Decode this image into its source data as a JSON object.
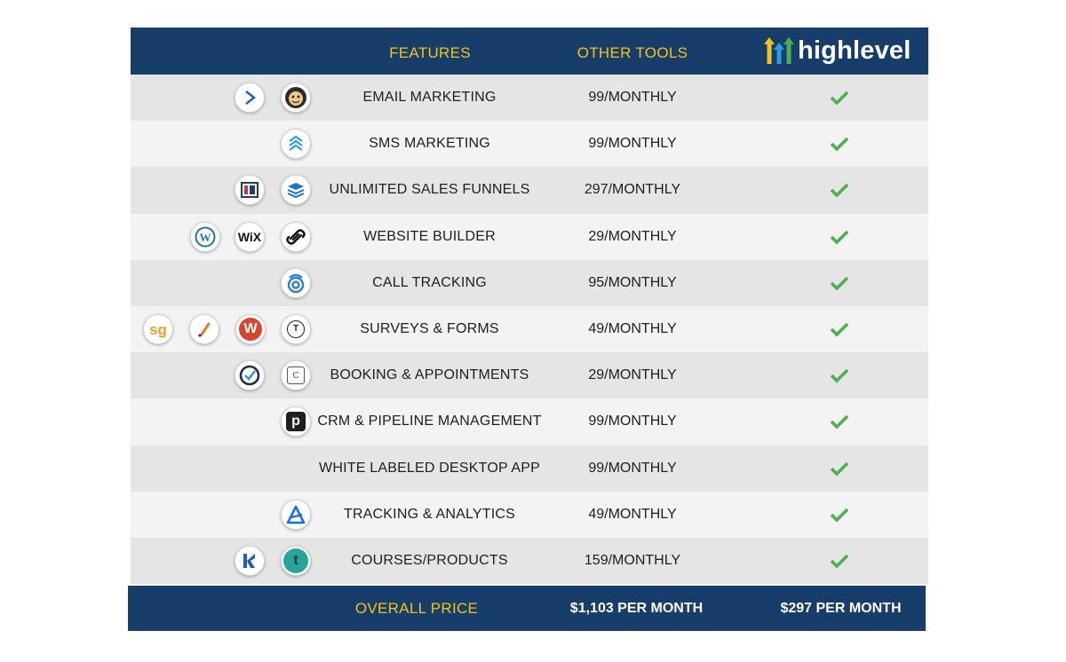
{
  "header": {
    "features_label": "FEATURES",
    "other_tools_label": "OTHER TOOLS",
    "brand_name": "highlevel"
  },
  "colors": {
    "header_bg": "#173e6b",
    "header_text": "#f5c21b",
    "check": "#4caf50",
    "row_odd": "#e5e5e5",
    "row_even": "#f3f3f3"
  },
  "rows": [
    {
      "feature": "EMAIL MARKETING",
      "price": "99/MONTHLY",
      "included": true,
      "icons": [
        "activecampaign-icon",
        "mailchimp-icon"
      ]
    },
    {
      "feature": "SMS MARKETING",
      "price": "99/MONTHLY",
      "included": true,
      "icons": [
        "sms-tool-icon"
      ]
    },
    {
      "feature": "UNLIMITED SALES FUNNELS",
      "price": "297/MONTHLY",
      "included": true,
      "icons": [
        "clickfunnels-icon",
        "leadpages-icon"
      ]
    },
    {
      "feature": "WEBSITE BUILDER",
      "price": "29/MONTHLY",
      "included": true,
      "icons": [
        "wordpress-icon",
        "wix-icon",
        "squarespace-icon"
      ]
    },
    {
      "feature": "CALL TRACKING",
      "price": "95/MONTHLY",
      "included": true,
      "icons": [
        "calltracking-icon"
      ]
    },
    {
      "feature": "SURVEYS & FORMS",
      "price": "49/MONTHLY",
      "included": true,
      "icons": [
        "surveygizmo-icon",
        "jotform-icon",
        "wufoo-icon",
        "typeform-icon"
      ]
    },
    {
      "feature": "BOOKING & APPOINTMENTS",
      "price": "29/MONTHLY",
      "included": true,
      "icons": [
        "acuity-icon",
        "calendly-icon"
      ]
    },
    {
      "feature": "CRM & PIPELINE MANAGEMENT",
      "price": "99/MONTHLY",
      "included": true,
      "icons": [
        "pipedrive-icon"
      ]
    },
    {
      "feature": "WHITE LABELED DESKTOP APP",
      "price": "99/MONTHLY",
      "included": true,
      "icons": []
    },
    {
      "feature": "TRACKING & ANALYTICS",
      "price": "49/MONTHLY",
      "included": true,
      "icons": [
        "analytics-icon"
      ]
    },
    {
      "feature": "COURSES/PRODUCTS",
      "price": "159/MONTHLY",
      "included": true,
      "icons": [
        "kajabi-icon",
        "teachable-icon"
      ]
    }
  ],
  "icon_text": {
    "wix": "WiX",
    "surveygizmo": "sg",
    "wufoo": "W",
    "typeform": "T",
    "calendly": "C",
    "pipedrive": "p",
    "teachable": "t"
  },
  "footer": {
    "label": "OVERALL PRICE",
    "other_total": "$1,103 PER MONTH",
    "highlevel_total": "$297 PER MONTH"
  }
}
